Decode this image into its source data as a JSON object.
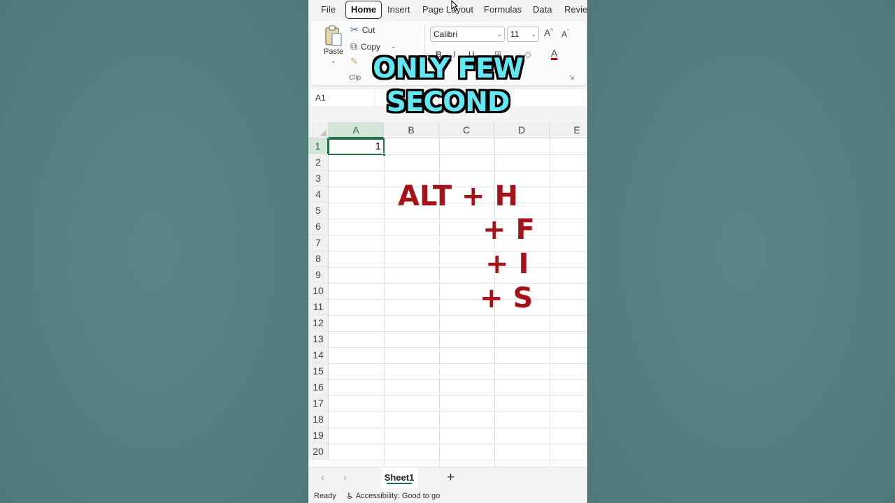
{
  "ribbon_tabs": [
    {
      "label": "File"
    },
    {
      "label": "Home"
    },
    {
      "label": "Insert"
    },
    {
      "label": "Page Layout"
    },
    {
      "label": "Formulas"
    },
    {
      "label": "Data"
    },
    {
      "label": "Review"
    }
  ],
  "active_tab": "Home",
  "clipboard": {
    "paste_label": "Paste",
    "cut_label": "Cut",
    "copy_label": "Copy",
    "group_label": "Clip"
  },
  "font": {
    "name": "Calibri",
    "size": "11",
    "bold": "B",
    "italic": "I",
    "underline": "U",
    "grow": "A",
    "shrink": "A",
    "color_glyph": "A"
  },
  "name_box": "A1",
  "columns": [
    "A",
    "B",
    "C",
    "D",
    "E"
  ],
  "rows": [
    "1",
    "2",
    "3",
    "4",
    "5",
    "6",
    "7",
    "8",
    "9",
    "10",
    "11",
    "12",
    "13",
    "14",
    "15",
    "16",
    "17",
    "18",
    "19",
    "20"
  ],
  "cell_a1": "1",
  "overlay_title": {
    "line1": "ONLY FEW",
    "line2": "SECOND"
  },
  "shortcut": {
    "line1": "ALT  +  H",
    "line2": "+  F",
    "line3": "+  I",
    "line4": "+  S"
  },
  "sheet_tab": "Sheet1",
  "add_sheet": "+",
  "status": {
    "ready": "Ready",
    "accessibility": "Accessibility: Good to go"
  },
  "colors": {
    "excel_green": "#217346",
    "shortcut_red": "#a4121a",
    "title_cyan": "#62e8f2"
  }
}
